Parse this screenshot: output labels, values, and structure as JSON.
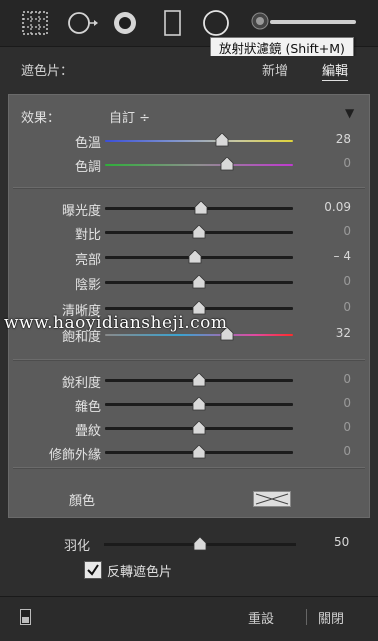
{
  "tooltip": "放射狀濾鏡 (Shift+M)",
  "header": {
    "label": "遮色片：",
    "new": "新增",
    "edit": "編輯"
  },
  "effect": {
    "label": "效果：",
    "value": "自訂 ÷"
  },
  "sliders": [
    {
      "name": "色溫",
      "value": "28",
      "pos": 0.62,
      "track": "temp"
    },
    {
      "name": "色調",
      "value": "0",
      "pos": 0.65,
      "track": "tint"
    },
    {
      "name": "曝光度",
      "value": "0.09",
      "pos": 0.51,
      "track": "plain"
    },
    {
      "name": "對比",
      "value": "0",
      "pos": 0.5,
      "track": "plain"
    },
    {
      "name": "亮部",
      "value": "– 4",
      "pos": 0.48,
      "track": "plain"
    },
    {
      "name": "陰影",
      "value": "0",
      "pos": 0.5,
      "track": "plain"
    },
    {
      "name": "清晰度",
      "value": "0",
      "pos": 0.5,
      "track": "plain"
    },
    {
      "name": "飽和度",
      "value": "32",
      "pos": 0.65,
      "track": "sat"
    },
    {
      "name": "銳利度",
      "value": "0",
      "pos": 0.5,
      "track": "plain"
    },
    {
      "name": "雜色",
      "value": "0",
      "pos": 0.5,
      "track": "plain"
    },
    {
      "name": "疊紋",
      "value": "0",
      "pos": 0.5,
      "track": "plain"
    },
    {
      "name": "修飾外緣",
      "value": "0",
      "pos": 0.5,
      "track": "plain"
    }
  ],
  "color_label": "顏色",
  "feather": {
    "label": "羽化",
    "value": "50",
    "pos": 0.5
  },
  "invert_label": "反轉遮色片",
  "footer": {
    "reset": "重設",
    "close": "關閉"
  },
  "watermark": "www.haoyidiansheji.com",
  "colors": {
    "panel": "#5b5b5b",
    "toolbar": "#262626",
    "knob": "#d9d9d9"
  }
}
